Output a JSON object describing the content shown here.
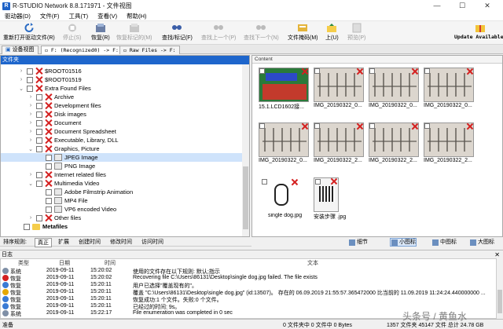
{
  "window": {
    "title": "R-STUDIO Network 8.8.171971 - 文件视图",
    "logo": "R",
    "controls": [
      "—",
      "☐",
      "✕"
    ]
  },
  "menu": [
    "驱动器(D)",
    "文件(F)",
    "工具(T)",
    "查看(V)",
    "帮助(H)"
  ],
  "toolbar": {
    "items": [
      {
        "label": "重新打开驱动文件(R)",
        "icon": "refresh-icon",
        "enabled": true
      },
      {
        "label": "停止(S)",
        "icon": "stop-icon",
        "enabled": false
      },
      {
        "label": "恢复(R)",
        "icon": "recover-icon",
        "enabled": true
      },
      {
        "label": "恢复标记的(M)",
        "icon": "recover-marked-icon",
        "enabled": false
      },
      {
        "label": "查找/标记(F)",
        "icon": "find-mark-icon",
        "enabled": true
      },
      {
        "label": "查找上一个(P)",
        "icon": "find-prev-icon",
        "enabled": false
      },
      {
        "label": "查找下一个(N)",
        "icon": "find-next-icon",
        "enabled": false
      },
      {
        "label": "文件掩码(M)",
        "icon": "file-mask-icon",
        "enabled": true
      },
      {
        "label": "上(U)",
        "icon": "up-icon",
        "enabled": true
      },
      {
        "label": "预览(P)",
        "icon": "preview-icon",
        "enabled": false
      },
      {
        "label": "Update Available!",
        "icon": "update-icon",
        "enabled": true
      }
    ]
  },
  "tabs": [
    {
      "label": "设备视图",
      "active": false
    },
    {
      "label": "F: (Recognized0) -> F:",
      "active": true
    },
    {
      "label": "Raw Files -> F:",
      "active": false
    }
  ],
  "tree": {
    "header": "文件夹",
    "rows": [
      {
        "label": "$ROOT01516",
        "level": 1,
        "chev": "›"
      },
      {
        "label": "$ROOT01519",
        "level": 1,
        "chev": "›"
      },
      {
        "label": "Extra Found Files",
        "level": 1,
        "chev": "⌄"
      },
      {
        "label": "Archive",
        "level": 2,
        "chev": "›"
      },
      {
        "label": "Development files",
        "level": 2,
        "chev": "›"
      },
      {
        "label": "Disk images",
        "level": 2,
        "chev": "›"
      },
      {
        "label": "Document",
        "level": 2,
        "chev": "›"
      },
      {
        "label": "Document Spreadsheet",
        "level": 2,
        "chev": "›"
      },
      {
        "label": "Executable, Library, DLL",
        "level": 2,
        "chev": "›"
      },
      {
        "label": "Graphics, Picture",
        "level": 2,
        "chev": "⌄"
      },
      {
        "label": "JPEG Image",
        "level": 3,
        "chev": "",
        "selected": true
      },
      {
        "label": "PNG Image",
        "level": 3,
        "chev": ""
      },
      {
        "label": "Internet related files",
        "level": 2,
        "chev": "›"
      },
      {
        "label": "Multimedia Video",
        "level": 2,
        "chev": "⌄"
      },
      {
        "label": "Adobe Filmstrip Animation",
        "level": 3,
        "chev": ""
      },
      {
        "label": "MP4 File",
        "level": 3,
        "chev": ""
      },
      {
        "label": "VP6 encoded Video",
        "level": 3,
        "chev": ""
      },
      {
        "label": "Other files",
        "level": 2,
        "chev": "›"
      },
      {
        "label": "Metafiles",
        "level": 0,
        "chev": "",
        "bold": true
      }
    ]
  },
  "content": {
    "header": "Content",
    "items": [
      {
        "label": "15.1.LCD1602接..."
      },
      {
        "label": "IMG_20190322_0..."
      },
      {
        "label": "IMG_20190322_0..."
      },
      {
        "label": "IMG_20190322_0..."
      },
      {
        "label": "IMG_20190322_0..."
      },
      {
        "label": "IMG_20190322_2..."
      },
      {
        "label": "IMG_20190322_2..."
      },
      {
        "label": "IMG_20190322_2..."
      },
      {
        "label": "single dog.jpg"
      },
      {
        "label": "安装步骤 .jpg"
      }
    ]
  },
  "sortbar": {
    "label": "排序规则:",
    "items": [
      "真正",
      "扩展",
      "创建时间",
      "修改时间",
      "访问时间"
    ]
  },
  "viewbar": {
    "items": [
      "细节",
      "小图标",
      "中图标",
      "大图标"
    ],
    "active": "小图标"
  },
  "log": {
    "title": "日志",
    "columns": [
      "类型",
      "日期",
      "时间",
      "文本"
    ],
    "rows": [
      {
        "type": "系统",
        "date": "2019-09-11",
        "time": "15:20:02",
        "text": "使用的文件存在以下规则: 默认;指示",
        "color": "#7f8fa6"
      },
      {
        "type": "恢复",
        "date": "2019-09-11",
        "time": "15:20:02",
        "text": "Recovering file C:\\Users\\86131\\Desktop\\single dog.jpg failed. The file exists",
        "color": "#d42020"
      },
      {
        "type": "恢复",
        "date": "2019-09-11",
        "time": "15:20:11",
        "text": "用户已选择\"覆盖现有的\"。",
        "color": "#3a7bd5"
      },
      {
        "type": "恢复",
        "date": "2019-09-11",
        "time": "15:20:11",
        "text": "覆盖 \"C:\\Users\\86131\\Desktop\\single dog.jpg\" (id:13507)。 存在的 06.09.2019 21:55:57.365472000 比当前的 11.09.2019 11:24:24.440000000 ...",
        "color": "#e6a800"
      },
      {
        "type": "恢复",
        "date": "2019-09-11",
        "time": "15:20:11",
        "text": "恢复成功:1 个文件。失败:0 个文件。",
        "color": "#3a7bd5"
      },
      {
        "type": "恢复",
        "date": "2019-09-11",
        "time": "15:20:11",
        "text": "已经过的时间: 9s。",
        "color": "#3a7bd5"
      },
      {
        "type": "系统",
        "date": "2019-09-11",
        "time": "15:22:17",
        "text": "File enumeration was completed in 0 sec",
        "color": "#7f8fa6"
      }
    ]
  },
  "status": {
    "ready": "准备",
    "files": "0 文件夹中 0 文件中 0 Bytes",
    "total": "1357 文件夹 45147 文件 总计 24.78 GB"
  },
  "watermark": "头条号 / 黄鱼水"
}
